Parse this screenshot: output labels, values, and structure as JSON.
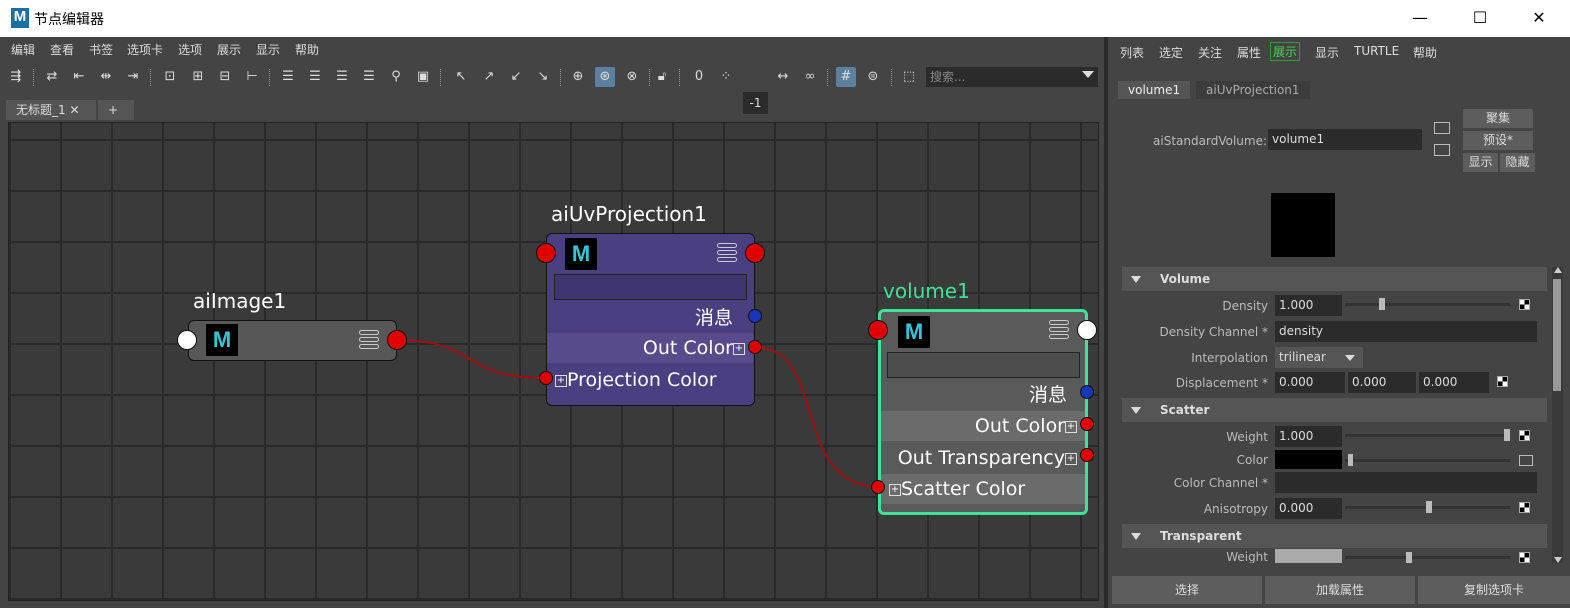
{
  "window": {
    "title": "节点编辑器",
    "logo": "M",
    "minimize": "—",
    "maximize": "☐",
    "close": "✕"
  },
  "menu": [
    "编辑",
    "查看",
    "书签",
    "选项卡",
    "选项",
    "展示",
    "显示",
    "帮助"
  ],
  "toolbar": {
    "minus_one": "-1",
    "search_placeholder": "搜索..."
  },
  "tabs": [
    {
      "label": "无标题_1 ✕"
    },
    {
      "label": "+"
    }
  ],
  "graph": {
    "node_icon": "M",
    "nodes": [
      {
        "title": "aiImage1"
      },
      {
        "title": "aiUvProjection1",
        "message": "消息",
        "out_color": "Out Color",
        "in_port": "Projection Color"
      },
      {
        "title": "volume1",
        "message": "消息",
        "out_color": "Out Color",
        "out_transparency": "Out Transparency",
        "in_port": "Scatter Color"
      }
    ],
    "colors": {
      "projection_node": "#4a3f80",
      "volume_border": "#3ee39a",
      "port_red": "#e00000",
      "port_blue": "#1736b8",
      "wire": "#c00000",
      "plus": "⊞"
    }
  },
  "attr_editor": {
    "menu": [
      "列表",
      "选定",
      "关注",
      "属性",
      "展示",
      "显示",
      "TURTLE",
      "帮助"
    ],
    "tabs": [
      "volume1",
      "aiUvProjection1"
    ],
    "type_label": "aiStandardVolume:",
    "node_name": "volume1",
    "buttons": {
      "focus": "聚集",
      "preset": "预设*",
      "show": "显示",
      "hide": "隐藏"
    },
    "sections": [
      {
        "title": "Volume",
        "attrs": [
          {
            "label": "Density",
            "value": "1.000",
            "slider": 0.3
          },
          {
            "label": "Density Channel *",
            "value": "density"
          },
          {
            "label": "Interpolation",
            "value": "trilinear"
          },
          {
            "label": "Displacement *",
            "values": [
              "0.000",
              "0.000",
              "0.000"
            ]
          }
        ]
      },
      {
        "title": "Scatter",
        "attrs": [
          {
            "label": "Weight",
            "value": "1.000",
            "slider": 1.0
          },
          {
            "label": "Color",
            "color": "#000000"
          },
          {
            "label": "Color Channel *",
            "value": ""
          },
          {
            "label": "Anisotropy",
            "value": "0.000",
            "slider": 0.5
          }
        ]
      },
      {
        "title": "Transparent",
        "attrs": [
          {
            "label": "Weight"
          }
        ]
      }
    ],
    "footer": [
      "选择",
      "加载属性",
      "复制选项卡"
    ]
  }
}
